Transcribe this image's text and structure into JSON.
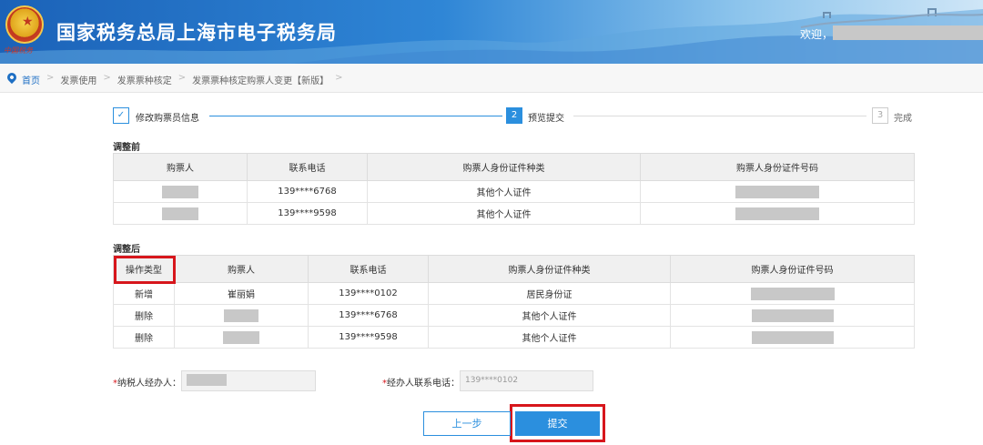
{
  "header": {
    "title": "国家税务总局上海市电子税务局",
    "emblem_sign": "中国税务",
    "welcome": "欢迎，"
  },
  "breadcrumb": {
    "items": [
      "首页",
      "发票使用",
      "发票票种核定",
      "发票票种核定购票人变更【新版】"
    ],
    "trailing_sep": ">"
  },
  "steps": [
    {
      "index": "✓",
      "label": "修改购票员信息"
    },
    {
      "index": "2",
      "label": "预览提交"
    },
    {
      "index": "3",
      "label": "完成"
    }
  ],
  "before": {
    "title": "调整前",
    "columns": [
      "购票人",
      "联系电话",
      "购票人身份证件种类",
      "购票人身份证件号码"
    ],
    "rows": [
      {
        "buyer": "",
        "phone": "139****6768",
        "id_type": "其他个人证件",
        "id_no": ""
      },
      {
        "buyer": "",
        "phone": "139****9598",
        "id_type": "其他个人证件",
        "id_no": ""
      }
    ]
  },
  "after": {
    "title": "调整后",
    "columns": [
      "操作类型",
      "购票人",
      "联系电话",
      "购票人身份证件种类",
      "购票人身份证件号码"
    ],
    "rows": [
      {
        "op": "新增",
        "buyer": "崔丽娟",
        "phone": "139****0102",
        "id_type": "居民身份证",
        "id_no": ""
      },
      {
        "op": "删除",
        "buyer": "",
        "phone": "139****6768",
        "id_type": "其他个人证件",
        "id_no": ""
      },
      {
        "op": "删除",
        "buyer": "",
        "phone": "139****9598",
        "id_type": "其他个人证件",
        "id_no": ""
      }
    ]
  },
  "form": {
    "agent_label": "纳税人经办人：",
    "agent_value": "",
    "phone_label": "经办人联系电话：",
    "phone_value": "139****0102",
    "required_mark": "*"
  },
  "buttons": {
    "prev": "上一步",
    "submit": "提交"
  },
  "colors": {
    "accent": "#2b8fde",
    "highlight": "#d7161c"
  }
}
